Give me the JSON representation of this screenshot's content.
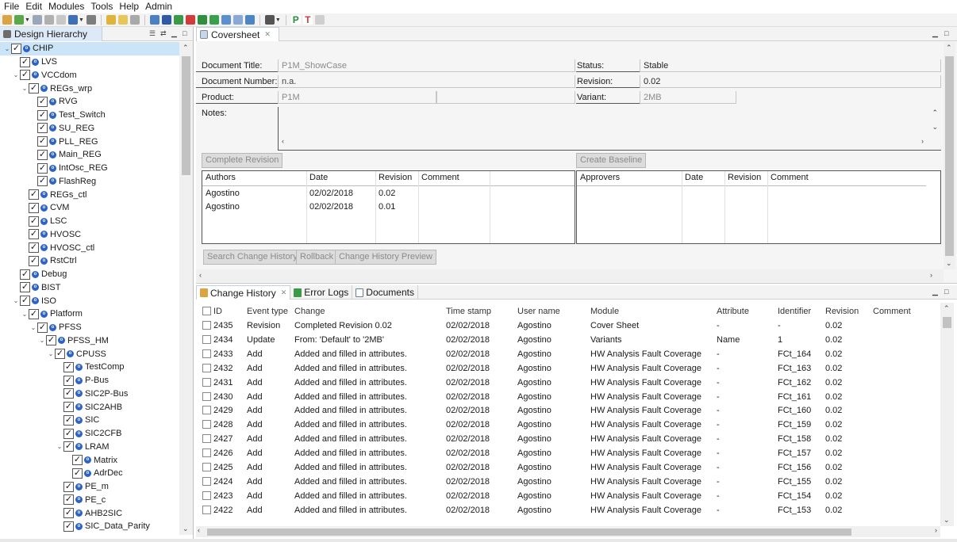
{
  "menubar": [
    "File",
    "Edit",
    "Modules",
    "Tools",
    "Help",
    "Admin"
  ],
  "left": {
    "tab_label": "Design Hierarchy",
    "tree": [
      {
        "label": "CHIP",
        "depth": 0,
        "twisty": "v",
        "selected": true
      },
      {
        "label": "LVS",
        "depth": 1,
        "twisty": ""
      },
      {
        "label": "VCCdom",
        "depth": 1,
        "twisty": "v"
      },
      {
        "label": "REGs_wrp",
        "depth": 2,
        "twisty": "v"
      },
      {
        "label": "RVG",
        "depth": 3,
        "twisty": ""
      },
      {
        "label": "Test_Switch",
        "depth": 3,
        "twisty": ""
      },
      {
        "label": "SU_REG",
        "depth": 3,
        "twisty": ""
      },
      {
        "label": "PLL_REG",
        "depth": 3,
        "twisty": ""
      },
      {
        "label": "Main_REG",
        "depth": 3,
        "twisty": ""
      },
      {
        "label": "IntOsc_REG",
        "depth": 3,
        "twisty": ""
      },
      {
        "label": "FlashReg",
        "depth": 3,
        "twisty": ""
      },
      {
        "label": "REGs_ctl",
        "depth": 2,
        "twisty": ""
      },
      {
        "label": "CVM",
        "depth": 2,
        "twisty": ""
      },
      {
        "label": "LSC",
        "depth": 2,
        "twisty": ""
      },
      {
        "label": "HVOSC",
        "depth": 2,
        "twisty": ""
      },
      {
        "label": "HVOSC_ctl",
        "depth": 2,
        "twisty": ""
      },
      {
        "label": "RstCtrl",
        "depth": 2,
        "twisty": ""
      },
      {
        "label": "Debug",
        "depth": 1,
        "twisty": ""
      },
      {
        "label": "BIST",
        "depth": 1,
        "twisty": ""
      },
      {
        "label": "ISO",
        "depth": 1,
        "twisty": "v"
      },
      {
        "label": "Platform",
        "depth": 2,
        "twisty": "v"
      },
      {
        "label": "PFSS",
        "depth": 3,
        "twisty": "v"
      },
      {
        "label": "PFSS_HM",
        "depth": 4,
        "twisty": "v"
      },
      {
        "label": "CPUSS",
        "depth": 5,
        "twisty": "v"
      },
      {
        "label": "TestComp",
        "depth": 6,
        "twisty": ""
      },
      {
        "label": "P-Bus",
        "depth": 6,
        "twisty": ""
      },
      {
        "label": "SIC2P-Bus",
        "depth": 6,
        "twisty": ""
      },
      {
        "label": "SIC2AHB",
        "depth": 6,
        "twisty": ""
      },
      {
        "label": "SIC",
        "depth": 6,
        "twisty": ""
      },
      {
        "label": "SIC2CFB",
        "depth": 6,
        "twisty": ""
      },
      {
        "label": "LRAM",
        "depth": 6,
        "twisty": "v"
      },
      {
        "label": "Matrix",
        "depth": 7,
        "twisty": ""
      },
      {
        "label": "AdrDec",
        "depth": 7,
        "twisty": ""
      },
      {
        "label": "PE_m",
        "depth": 6,
        "twisty": ""
      },
      {
        "label": "PE_c",
        "depth": 6,
        "twisty": ""
      },
      {
        "label": "AHB2SIC",
        "depth": 6,
        "twisty": ""
      },
      {
        "label": "SIC_Data_Parity",
        "depth": 6,
        "twisty": ""
      }
    ]
  },
  "cover": {
    "tab_label": "Coversheet",
    "doc_title_label": "Document Title:",
    "doc_title_value": "P1M_ShowCase",
    "doc_number_label": "Document Number:",
    "doc_number_value": "n.a.",
    "product_label": "Product:",
    "product_value": "P1M",
    "notes_label": "Notes:",
    "status_label": "Status:",
    "status_value": "Stable",
    "revision_label": "Revision:",
    "revision_value": "0.02",
    "variant_label": "Variant:",
    "variant_value": "2MB",
    "complete_revision_btn": "Complete Revision",
    "create_baseline_btn": "Create Baseline",
    "authors_headers": [
      "Authors",
      "Date",
      "Revision",
      "Comment"
    ],
    "authors_rows": [
      [
        "Agostino",
        "02/02/2018",
        "0.02",
        ""
      ],
      [
        "Agostino",
        "02/02/2018",
        "0.01",
        ""
      ]
    ],
    "approvers_headers": [
      "Approvers",
      "Date",
      "Revision",
      "Comment"
    ],
    "search_btn": "Search Change History",
    "rollback_btn": "Rollback",
    "preview_btn": "Change History Preview"
  },
  "bottom": {
    "tabs": [
      "Change History",
      "Error Logs",
      "Documents"
    ],
    "headers": [
      "ID",
      "Event type",
      "Change",
      "Time stamp",
      "User name",
      "Module",
      "Attribute",
      "Identifier",
      "Revision",
      "Comment"
    ],
    "rows": [
      [
        "2435",
        "Revision",
        "Completed Revision 0.02",
        "02/02/2018",
        "Agostino",
        "Cover Sheet",
        "-",
        "-",
        "0.02"
      ],
      [
        "2434",
        "Update",
        "From: 'Default' to '2MB'",
        "02/02/2018",
        "Agostino",
        "Variants",
        "Name",
        "1",
        "0.02"
      ],
      [
        "2433",
        "Add",
        "Added and filled in attributes.",
        "02/02/2018",
        "Agostino",
        "HW Analysis Fault Coverage",
        "-",
        "FCt_164",
        "0.02"
      ],
      [
        "2432",
        "Add",
        "Added and filled in attributes.",
        "02/02/2018",
        "Agostino",
        "HW Analysis Fault Coverage",
        "-",
        "FCt_163",
        "0.02"
      ],
      [
        "2431",
        "Add",
        "Added and filled in attributes.",
        "02/02/2018",
        "Agostino",
        "HW Analysis Fault Coverage",
        "-",
        "FCt_162",
        "0.02"
      ],
      [
        "2430",
        "Add",
        "Added and filled in attributes.",
        "02/02/2018",
        "Agostino",
        "HW Analysis Fault Coverage",
        "-",
        "FCt_161",
        "0.02"
      ],
      [
        "2429",
        "Add",
        "Added and filled in attributes.",
        "02/02/2018",
        "Agostino",
        "HW Analysis Fault Coverage",
        "-",
        "FCt_160",
        "0.02"
      ],
      [
        "2428",
        "Add",
        "Added and filled in attributes.",
        "02/02/2018",
        "Agostino",
        "HW Analysis Fault Coverage",
        "-",
        "FCt_159",
        "0.02"
      ],
      [
        "2427",
        "Add",
        "Added and filled in attributes.",
        "02/02/2018",
        "Agostino",
        "HW Analysis Fault Coverage",
        "-",
        "FCt_158",
        "0.02"
      ],
      [
        "2426",
        "Add",
        "Added and filled in attributes.",
        "02/02/2018",
        "Agostino",
        "HW Analysis Fault Coverage",
        "-",
        "FCt_157",
        "0.02"
      ],
      [
        "2425",
        "Add",
        "Added and filled in attributes.",
        "02/02/2018",
        "Agostino",
        "HW Analysis Fault Coverage",
        "-",
        "FCt_156",
        "0.02"
      ],
      [
        "2424",
        "Add",
        "Added and filled in attributes.",
        "02/02/2018",
        "Agostino",
        "HW Analysis Fault Coverage",
        "-",
        "FCt_155",
        "0.02"
      ],
      [
        "2423",
        "Add",
        "Added and filled in attributes.",
        "02/02/2018",
        "Agostino",
        "HW Analysis Fault Coverage",
        "-",
        "FCt_154",
        "0.02"
      ],
      [
        "2422",
        "Add",
        "Added and filled in attributes.",
        "02/02/2018",
        "Agostino",
        "HW Analysis Fault Coverage",
        "-",
        "FCt_153",
        "0.02"
      ]
    ]
  },
  "colors": {
    "accent": "#2d63c8",
    "selection": "#cce4f7"
  }
}
